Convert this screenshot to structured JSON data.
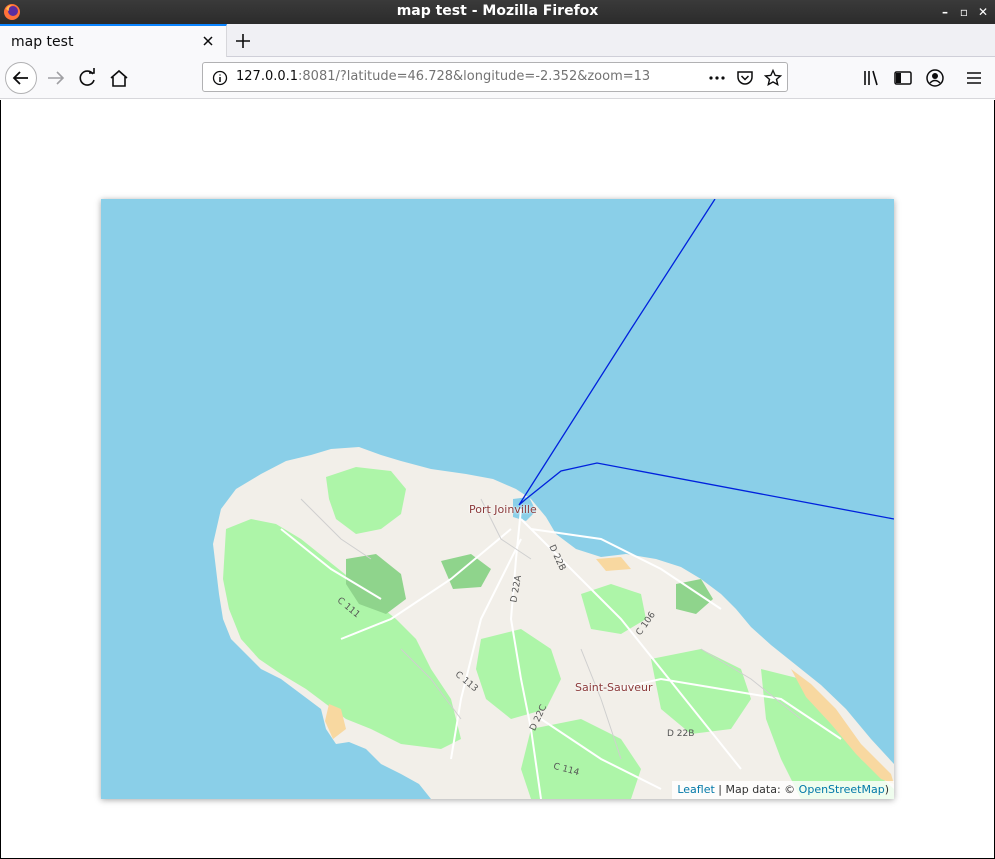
{
  "window": {
    "title": "map test - Mozilla Firefox",
    "controls": [
      "minimize-icon",
      "maximize-icon",
      "close-icon"
    ]
  },
  "tabs": [
    {
      "label": "map test",
      "active": true
    }
  ],
  "toolbar": {
    "url_host": "127.0.0.1",
    "url_rest": ":8081/?latitude=46.728&longitude=-2.352&zoom=13",
    "icons": [
      "back-icon",
      "forward-icon",
      "reload-icon",
      "home-icon",
      "site-info-icon",
      "page-actions-icon",
      "pocket-icon",
      "bookmark-star-icon",
      "library-icon",
      "sidebar-icon",
      "account-icon",
      "menu-icon"
    ]
  },
  "map": {
    "center": {
      "latitude": "46.728",
      "longitude": "-2.352"
    },
    "zoom": "13",
    "colors": {
      "water": "#8acfe8",
      "land": "#f2efe9",
      "forest": "#adf5a8",
      "dark_forest": "#8fd48c",
      "sand": "#f8d8a0",
      "route": "#0022dd"
    },
    "places": [
      {
        "name": "Port Joinville"
      },
      {
        "name": "Saint-Sauveur"
      }
    ],
    "roads": [
      "D 22B",
      "D 22A",
      "C 111",
      "C 106",
      "C 113",
      "D 22C",
      "D 22B",
      "C 114"
    ],
    "attribution": {
      "leaflet": "Leaflet",
      "separator": " | Map data: © ",
      "osm": "OpenStreetMap",
      "close": ")"
    }
  }
}
